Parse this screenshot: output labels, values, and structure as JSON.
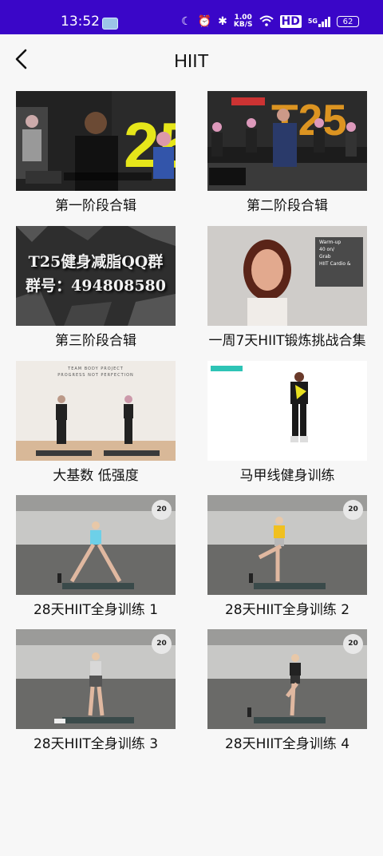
{
  "status_bar": {
    "time": "13:52",
    "net_speed_value": "1.00",
    "net_speed_unit": "KB/S",
    "hd": "HD",
    "signal": "5G",
    "battery": "62"
  },
  "header": {
    "title": "HIIT"
  },
  "videos": [
    {
      "label": "第一阶段合辑"
    },
    {
      "label": "第二阶段合辑"
    },
    {
      "label": "第三阶段合辑",
      "thumb_text_1": "T25健身减脂QQ群",
      "thumb_text_2": "群号：494808580"
    },
    {
      "label": "一周7天HIIT锻炼挑战合集",
      "thumb_list": [
        "Warm-up",
        "40 on/",
        "Grab",
        "HIIT Cardio &"
      ]
    },
    {
      "label": "大基数 低强度",
      "thumb_text_1": "TEAM BODY PROJECT",
      "thumb_text_2": "PROGRESS NOT PERFECTION"
    },
    {
      "label": "马甲线健身训练"
    },
    {
      "label": "28天HIIT全身训练 1",
      "badge": "20"
    },
    {
      "label": "28天HIIT全身训练 2",
      "badge": "20"
    },
    {
      "label": "28天HIIT全身训练 3",
      "badge": "20"
    },
    {
      "label": "28天HIIT全身训练 4",
      "badge": "20"
    }
  ],
  "colors": {
    "status_bar": "#3a06c8",
    "background": "#f7f7f7"
  }
}
